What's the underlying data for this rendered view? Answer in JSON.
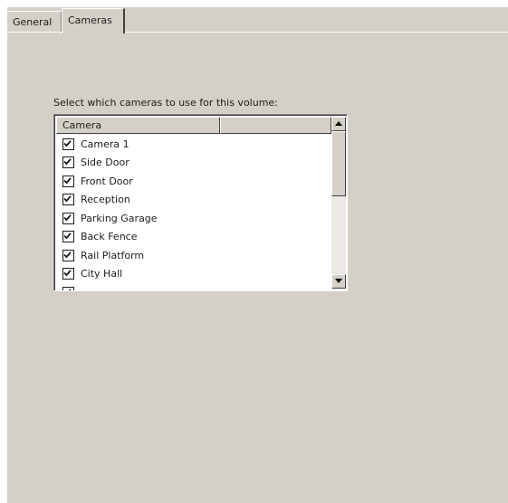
{
  "tabs": [
    {
      "label": "General",
      "selected": false
    },
    {
      "label": "Cameras",
      "selected": true
    }
  ],
  "prompt": "Select which cameras to use for this volume:",
  "list": {
    "columns": [
      "Camera",
      ""
    ],
    "rows": [
      {
        "label": "Camera 1",
        "checked": true
      },
      {
        "label": "Side Door",
        "checked": true
      },
      {
        "label": "Front Door",
        "checked": true
      },
      {
        "label": "Reception",
        "checked": true
      },
      {
        "label": "Parking Garage",
        "checked": true
      },
      {
        "label": "Back Fence",
        "checked": true
      },
      {
        "label": "Rail Platform",
        "checked": true
      },
      {
        "label": "City Hall",
        "checked": true
      },
      {
        "label": "",
        "checked": true
      }
    ]
  },
  "scrollbar": {
    "up_icon": "arrow-up-icon",
    "down_icon": "arrow-down-icon"
  },
  "colors": {
    "panel": "#d4d0c8",
    "list_background": "#ffffff"
  }
}
